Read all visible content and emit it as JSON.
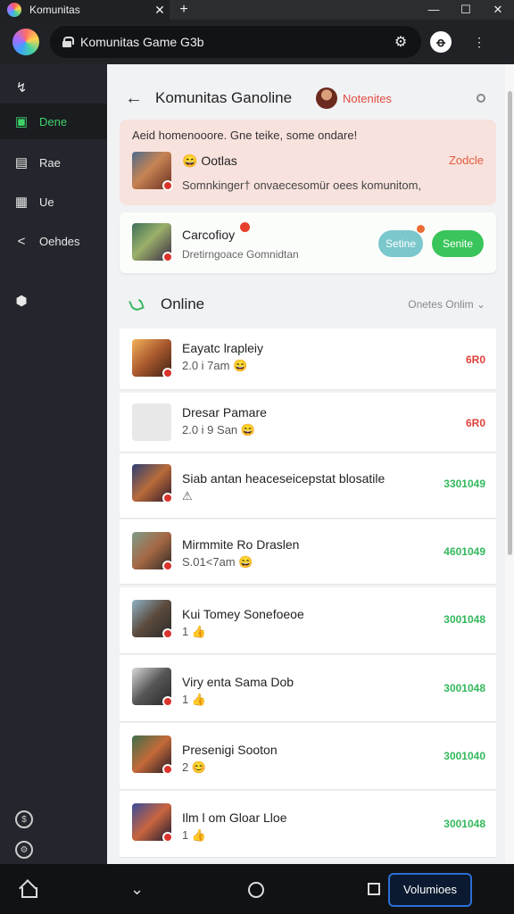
{
  "browser": {
    "tab_title": "Komunitas",
    "tab_close": "✕",
    "new_tab": "+",
    "win_min": "—",
    "win_max": "☐",
    "win_close": "✕",
    "url": "Komunitas Game G3b"
  },
  "sidebar": {
    "items": [
      {
        "icon": "pulse-icon",
        "glyph": "↯",
        "label": ""
      },
      {
        "icon": "game-icon",
        "glyph": "▣",
        "label": "Dene"
      },
      {
        "icon": "board-icon",
        "glyph": "▤",
        "label": "Rae"
      },
      {
        "icon": "grid-icon",
        "glyph": "▦",
        "label": "Ue"
      },
      {
        "icon": "share-icon",
        "glyph": "<",
        "label": "Oehdes"
      },
      {
        "icon": "shield-icon",
        "glyph": "⬢",
        "label": ""
      }
    ],
    "bottom_icons": [
      {
        "icon": "coin-icon",
        "glyph": "$"
      },
      {
        "icon": "settings-icon",
        "glyph": "⚙"
      }
    ]
  },
  "header": {
    "title": "Komunitas Ganoline",
    "link": "Notenites"
  },
  "notice": {
    "headline": "Aeid homenooore. Gne teike, some ondare!",
    "name": "Ootlas",
    "name_emoji": "😄",
    "description": "Somnkinger† onvaecesomür oees komunitom,",
    "action": "Zodcle"
  },
  "invite": {
    "name": "Carcofioy",
    "description": "Dretirngoace Gomnidtan",
    "secondary_label": "Setine",
    "primary_label": "Senite"
  },
  "section": {
    "title": "Online",
    "filter": "Onetes Onlim ⌄"
  },
  "list": [
    {
      "name": "Eayatc lrapleiy",
      "sub": "2.0 i 7am 😄",
      "value": "6R0",
      "value_color": "#e0403a"
    },
    {
      "name": "Dresar Pamare",
      "sub": "2.0 i 9 San 😄",
      "value": "6R0",
      "value_color": "#e0403a"
    },
    {
      "name": "Siab antan heaceseicepstat blosatile",
      "sub": "⚠",
      "value": "3301049",
      "value_color": "#33b85c"
    },
    {
      "name": "Mirmmite Ro Draslen",
      "sub": "S.01<7am 😄",
      "value": "4601049",
      "value_color": "#33b85c"
    },
    {
      "name": "Kui Tomey Sonefoeoe",
      "sub": "1 👍",
      "value": "3001048",
      "value_color": "#33b85c"
    },
    {
      "name": "Viry enta Sama Dob",
      "sub": "1 👍",
      "value": "3001048",
      "value_color": "#33b85c"
    },
    {
      "name": "Presenigi Sooton",
      "sub": "2 😊",
      "value": "3001040",
      "value_color": "#33b85c"
    },
    {
      "name": "Ilm l om Gloar Lloe",
      "sub": "1 👍",
      "value": "3001048",
      "value_color": "#33b85c"
    }
  ],
  "bottom": {
    "back": "⌄",
    "volume_label": "Volumioes"
  },
  "colors": {
    "accent_green": "#39c55b",
    "accent_red": "#e34b3f",
    "sidebar_bg": "#23262c"
  }
}
